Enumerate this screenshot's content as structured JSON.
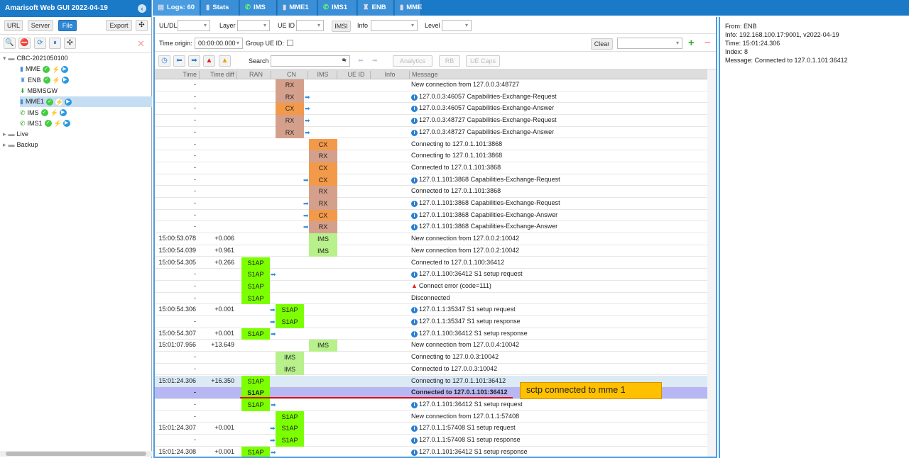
{
  "app": {
    "title": "Amarisoft Web GUI 2022-04-19"
  },
  "left": {
    "buttons": {
      "url": "URL",
      "server": "Server",
      "file": "File",
      "export": "Export"
    },
    "tree": [
      {
        "label": "CBC-2021050100",
        "level": 0,
        "type": "folder",
        "status": false
      },
      {
        "label": "MME",
        "level": 1,
        "type": "server",
        "status": true
      },
      {
        "label": "ENB",
        "level": 1,
        "type": "enb",
        "status": true
      },
      {
        "label": "MBMSGW",
        "level": 1,
        "type": "download",
        "status": false
      },
      {
        "label": "MME1",
        "level": 1,
        "type": "server",
        "status": true,
        "selected": true
      },
      {
        "label": "IMS",
        "level": 1,
        "type": "phone",
        "status": true
      },
      {
        "label": "IMS1",
        "level": 1,
        "type": "phone",
        "status": true
      },
      {
        "label": "Live",
        "level": 0,
        "type": "folder",
        "status": false
      },
      {
        "label": "Backup",
        "level": 0,
        "type": "folder",
        "status": false
      }
    ]
  },
  "tabs": [
    {
      "label": "Logs: 60",
      "icon": "doc"
    },
    {
      "label": "Stats",
      "icon": "chart"
    },
    {
      "label": "IMS",
      "icon": "phone"
    },
    {
      "label": "MME1",
      "icon": "server"
    },
    {
      "label": "IMS1",
      "icon": "phone"
    },
    {
      "label": "ENB",
      "icon": "enb"
    },
    {
      "label": "MME",
      "icon": "server"
    }
  ],
  "filters": {
    "uldl": "UL/DL",
    "layer": "Layer",
    "ueid": "UE ID",
    "imsi": "IMSI",
    "info": "Info",
    "level": "Level",
    "time_origin_label": "Time origin:",
    "time_origin": "00:00:00.000",
    "group": "Group UE ID:",
    "clear": "Clear",
    "search": "Search",
    "analytics": "Analytics",
    "rb": "RB",
    "uecaps": "UE Caps"
  },
  "columns": [
    "Time",
    "Time diff",
    "RAN",
    "CN",
    "IMS",
    "UE ID",
    "Info",
    "Message"
  ],
  "colors": {
    "RX": "#d4a08c",
    "CX": "#f39a4a",
    "IMS": "#b8f08c",
    "S1AP": "#7cff00"
  },
  "rows": [
    {
      "t": "-",
      "d": "",
      "col": "CN",
      "tag": "RX",
      "ar": "",
      "ic": "",
      "m": "New connection from 127.0.0.3:48727"
    },
    {
      "t": "-",
      "d": "",
      "col": "CN",
      "tag": "RX",
      "ar": "a",
      "ic": "i",
      "m": "127.0.0.3:46057 Capabilities-Exchange-Request"
    },
    {
      "t": "-",
      "d": "",
      "col": "CN",
      "tag": "CX",
      "ar": "a",
      "ic": "i",
      "m": "127.0.0.3:46057 Capabilities-Exchange-Answer"
    },
    {
      "t": "-",
      "d": "",
      "col": "CN",
      "tag": "RX",
      "ar": "a",
      "ic": "i",
      "m": "127.0.0.3:48727 Capabilities-Exchange-Request"
    },
    {
      "t": "-",
      "d": "",
      "col": "CN",
      "tag": "RX",
      "ar": "a",
      "ic": "i",
      "m": "127.0.0.3:48727 Capabilities-Exchange-Answer"
    },
    {
      "t": "-",
      "d": "",
      "col": "IMS",
      "tag": "CX",
      "ar": "",
      "ic": "",
      "m": "Connecting to 127.0.1.101:3868"
    },
    {
      "t": "-",
      "d": "",
      "col": "IMS",
      "tag": "RX",
      "ar": "",
      "ic": "",
      "m": "Connecting to 127.0.1.101:3868"
    },
    {
      "t": "-",
      "d": "",
      "col": "IMS",
      "tag": "CX",
      "ar": "",
      "ic": "",
      "m": "Connected to 127.0.1.101:3868"
    },
    {
      "t": "-",
      "d": "",
      "col": "IMS",
      "tag": "CX",
      "ar": "b",
      "ic": "i",
      "m": "127.0.1.101:3868 Capabilities-Exchange-Request"
    },
    {
      "t": "-",
      "d": "",
      "col": "IMS",
      "tag": "RX",
      "ar": "",
      "ic": "",
      "m": "Connected to 127.0.1.101:3868"
    },
    {
      "t": "-",
      "d": "",
      "col": "IMS",
      "tag": "RX",
      "ar": "b",
      "ic": "i",
      "m": "127.0.1.101:3868 Capabilities-Exchange-Request"
    },
    {
      "t": "-",
      "d": "",
      "col": "IMS",
      "tag": "CX",
      "ar": "b",
      "ic": "i",
      "m": "127.0.1.101:3868 Capabilities-Exchange-Answer"
    },
    {
      "t": "-",
      "d": "",
      "col": "IMS",
      "tag": "RX",
      "ar": "b",
      "ic": "i",
      "m": "127.0.1.101:3868 Capabilities-Exchange-Answer"
    },
    {
      "t": "15:00:53.078",
      "d": "+0.006",
      "col": "IMS",
      "tag": "IMS",
      "ar": "",
      "ic": "",
      "m": "New connection from 127.0.0.2:10042"
    },
    {
      "t": "15:00:54.039",
      "d": "+0.961",
      "col": "IMS",
      "tag": "IMS",
      "ar": "",
      "ic": "",
      "m": "New connection from 127.0.0.2:10042"
    },
    {
      "t": "15:00:54.305",
      "d": "+0.266",
      "col": "RAN",
      "tag": "S1AP",
      "ar": "",
      "ic": "",
      "m": "Connected to 127.0.1.100:36412"
    },
    {
      "t": "-",
      "d": "",
      "col": "RAN",
      "tag": "S1AP",
      "ar": "a",
      "ic": "i",
      "m": "127.0.1.100:36412 S1 setup request"
    },
    {
      "t": "-",
      "d": "",
      "col": "RAN",
      "tag": "S1AP",
      "ar": "",
      "ic": "w",
      "m": "Connect error (code=111)"
    },
    {
      "t": "-",
      "d": "",
      "col": "RAN",
      "tag": "S1AP",
      "ar": "",
      "ic": "",
      "m": "Disconnected"
    },
    {
      "t": "15:00:54.306",
      "d": "+0.001",
      "col": "CN",
      "tag": "S1AP",
      "ar": "b",
      "ic": "i",
      "m": "127.0.1.1:35347 S1 setup request"
    },
    {
      "t": "-",
      "d": "",
      "col": "CN",
      "tag": "S1AP",
      "ar": "b",
      "ic": "i",
      "m": "127.0.1.1:35347 S1 setup response"
    },
    {
      "t": "15:00:54.307",
      "d": "+0.001",
      "col": "RAN",
      "tag": "S1AP",
      "ar": "a",
      "ic": "i",
      "m": "127.0.1.100:36412 S1 setup response"
    },
    {
      "t": "15:01:07.956",
      "d": "+13.649",
      "col": "IMS",
      "tag": "IMS",
      "ar": "",
      "ic": "",
      "m": "New connection from 127.0.0.4:10042"
    },
    {
      "t": "-",
      "d": "",
      "col": "CN",
      "tag": "IMS",
      "ar": "",
      "ic": "",
      "m": "Connecting to 127.0.0.3:10042"
    },
    {
      "t": "-",
      "d": "",
      "col": "CN",
      "tag": "IMS",
      "ar": "",
      "ic": "",
      "m": "Connected to 127.0.0.3:10042"
    },
    {
      "t": "15:01:24.306",
      "d": "+16.350",
      "col": "RAN",
      "tag": "S1AP",
      "ar": "",
      "ic": "",
      "m": "Connecting to 127.0.1.101:36412",
      "state": "hl"
    },
    {
      "t": "-",
      "d": "",
      "col": "RAN",
      "tag": "S1AP",
      "ar": "",
      "ic": "",
      "m": "Connected to 127.0.1.101:36412",
      "state": "sl"
    },
    {
      "t": "-",
      "d": "",
      "col": "RAN",
      "tag": "S1AP",
      "ar": "a",
      "ic": "i",
      "m": "127.0.1.101:36412 S1 setup request"
    },
    {
      "t": "-",
      "d": "",
      "col": "CN",
      "tag": "S1AP",
      "ar": "",
      "ic": "",
      "m": "New connection from 127.0.1.1:57408"
    },
    {
      "t": "15:01:24.307",
      "d": "+0.001",
      "col": "CN",
      "tag": "S1AP",
      "ar": "b",
      "ic": "i",
      "m": "127.0.1.1:57408 S1 setup request"
    },
    {
      "t": "-",
      "d": "",
      "col": "CN",
      "tag": "S1AP",
      "ar": "b",
      "ic": "i",
      "m": "127.0.1.1:57408 S1 setup response"
    },
    {
      "t": "15:01:24.308",
      "d": "+0.001",
      "col": "RAN",
      "tag": "S1AP",
      "ar": "a",
      "ic": "i",
      "m": "127.0.1.101:36412 S1 setup response"
    }
  ],
  "details": {
    "from": "From: ENB",
    "info": "Info: 192.168.100.17:9001, v2022-04-19",
    "time": "Time: 15:01:24.306",
    "index": "Index: 8",
    "message": "Message: Connected to 127.0.1.101:36412"
  },
  "annotation": "sctp connected to mme 1"
}
